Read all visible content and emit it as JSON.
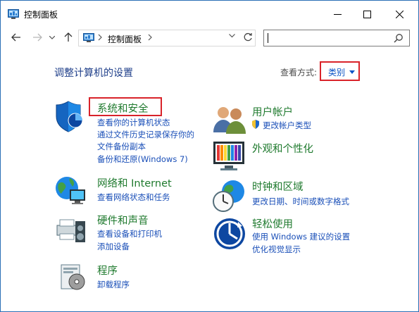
{
  "window": {
    "title": "控制面板",
    "controls": {
      "minimize": "—",
      "maximize": "☐",
      "close": "✕"
    }
  },
  "address": {
    "crumbs": [
      "控制面板"
    ],
    "search_value": ""
  },
  "header": {
    "heading": "调整计算机的设置",
    "view_by_label": "查看方式:",
    "view_by_value": "类别"
  },
  "categories": {
    "system_security": {
      "title": "系统和安全",
      "links": [
        "查看你的计算机状态",
        "通过文件历史记录保存你的",
        "文件备份副本",
        "备份和还原(Windows 7)"
      ]
    },
    "network": {
      "title": "网络和 Internet",
      "links": [
        "查看网络状态和任务"
      ]
    },
    "hardware": {
      "title": "硬件和声音",
      "links": [
        "查看设备和打印机",
        "添加设备"
      ]
    },
    "programs": {
      "title": "程序",
      "links": [
        "卸载程序"
      ]
    },
    "user_accounts": {
      "title": "用户帐户",
      "links": [
        "更改帐户类型"
      ]
    },
    "appearance": {
      "title": "外观和个性化",
      "links": []
    },
    "clock_region": {
      "title": "时钟和区域",
      "links": [
        "更改日期、时间或数字格式"
      ]
    },
    "ease_access": {
      "title": "轻松使用",
      "links": [
        "使用 Windows 建议的设置",
        "优化视觉显示"
      ]
    }
  },
  "colors": {
    "title_green": "#1f7a2e",
    "link_blue": "#1a4fb8",
    "heading_blue": "#1f3f8a",
    "highlight_red": "#d9232a"
  }
}
